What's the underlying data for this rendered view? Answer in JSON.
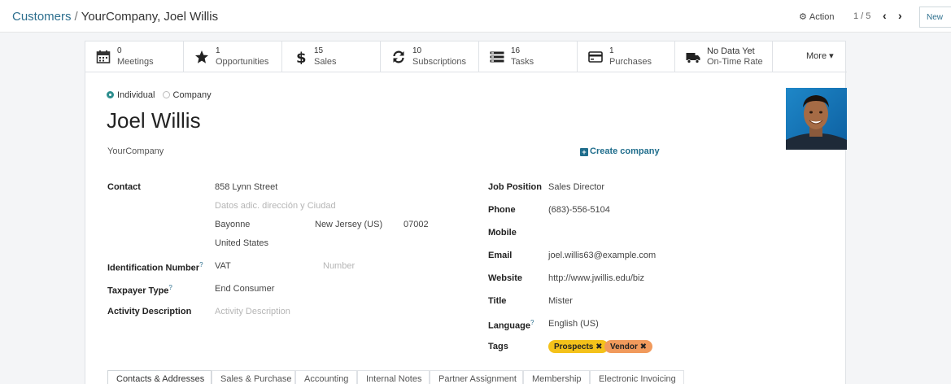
{
  "breadcrumb": {
    "parent": "Customers",
    "separator": "/",
    "current": "YourCompany, Joel Willis"
  },
  "toolbar": {
    "action_label": "Action",
    "pager": "1 / 5",
    "new_label": "New"
  },
  "smart_buttons": [
    {
      "value": "0",
      "label": "Meetings",
      "icon": "calendar-icon"
    },
    {
      "value": "1",
      "label": "Opportunities",
      "icon": "star-icon"
    },
    {
      "value": "15",
      "label": "Sales",
      "icon": "dollar-icon"
    },
    {
      "value": "10",
      "label": "Subscriptions",
      "icon": "refresh-icon"
    },
    {
      "value": "16",
      "label": "Tasks",
      "icon": "tasks-icon"
    },
    {
      "value": "1",
      "label": "Purchases",
      "icon": "credit-card-icon"
    },
    {
      "value": "No Data Yet",
      "label": "On-Time Rate",
      "icon": "truck-icon"
    }
  ],
  "more_label": "More ▾",
  "partner_type": {
    "individual": "Individual",
    "company": "Company",
    "selected": "individual"
  },
  "partner_name": "Joel Willis",
  "company_name": "YourCompany",
  "create_company_label": "Create company",
  "contact": {
    "label": "Contact",
    "street": "858 Lynn Street",
    "street2_placeholder": "Datos adic. dirección y Ciudad",
    "city": "Bayonne",
    "state": "New Jersey (US)",
    "zip": "07002",
    "country": "United States"
  },
  "identification": {
    "label": "Identification Number",
    "help": "?",
    "type": "VAT",
    "number_placeholder": "Number"
  },
  "taxpayer": {
    "label": "Taxpayer Type",
    "help": "?",
    "value": "End Consumer"
  },
  "activity": {
    "label": "Activity Description",
    "placeholder": "Activity Description"
  },
  "right_fields": {
    "job_position": {
      "label": "Job Position",
      "value": "Sales Director"
    },
    "phone": {
      "label": "Phone",
      "value": "(683)-556-5104"
    },
    "mobile": {
      "label": "Mobile",
      "value": ""
    },
    "email": {
      "label": "Email",
      "value": "joel.willis63@example.com"
    },
    "website": {
      "label": "Website",
      "value": "http://www.jwillis.edu/biz"
    },
    "title": {
      "label": "Title",
      "value": "Mister"
    },
    "language": {
      "label": "Language",
      "help": "?",
      "value": "English (US)"
    },
    "tags": {
      "label": "Tags"
    }
  },
  "tags": [
    {
      "label": "Prospects ✖",
      "color": "#f4c21a"
    },
    {
      "label": "Vendor ✖",
      "color": "#f19a5c"
    }
  ],
  "tabs": [
    "Contacts & Addresses",
    "Sales & Purchase",
    "Accounting",
    "Internal Notes",
    "Partner Assignment",
    "Membership",
    "Electronic Invoicing"
  ],
  "colors": {
    "link": "#2d6f8e",
    "radio": "#2d8e8e"
  }
}
